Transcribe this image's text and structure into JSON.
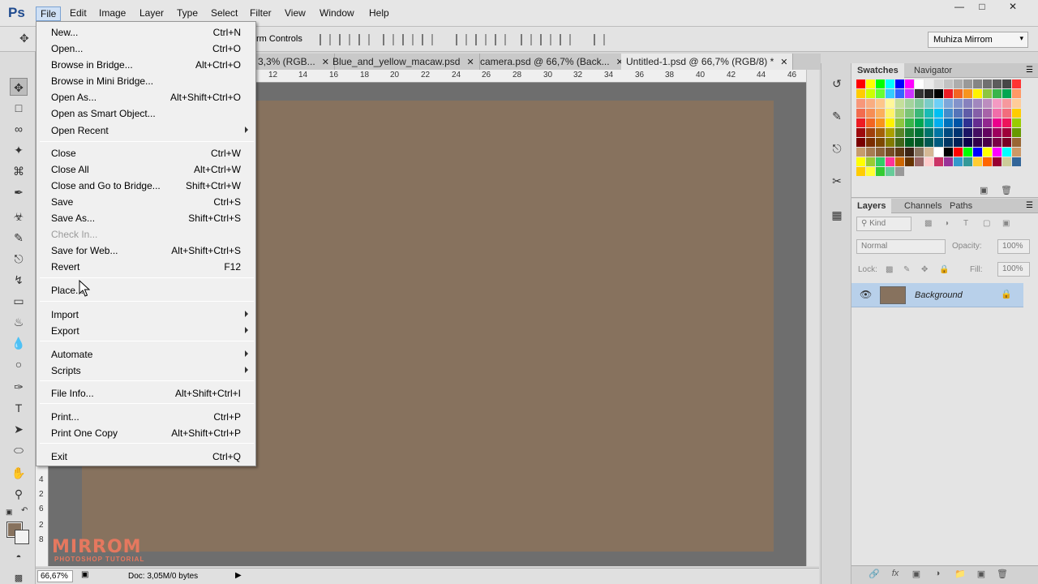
{
  "app": {
    "logo": "Ps",
    "menus": [
      "File",
      "Edit",
      "Image",
      "Layer",
      "Type",
      "Select",
      "Filter",
      "View",
      "Window",
      "Help"
    ],
    "active_menu": "File"
  },
  "options": {
    "partial_label": "rm Controls",
    "workspace": "Muhiza Mirrom"
  },
  "tabs": [
    {
      "label": "3,3% (RGB..."
    },
    {
      "label": "Blue_and_yellow_macaw.psd"
    },
    {
      "label": "camera.psd @ 66,7% (Back..."
    },
    {
      "label": "Untitled-1.psd @ 66,7% (RGB/8) *"
    }
  ],
  "ruler": {
    "h_ticks": [
      "12",
      "14",
      "16",
      "18",
      "20",
      "22",
      "24",
      "26",
      "28",
      "30",
      "32",
      "34",
      "36",
      "38",
      "40",
      "42",
      "44",
      "46"
    ],
    "v_ticks": [
      "4",
      "2",
      "6",
      "2",
      "8"
    ]
  },
  "status": {
    "zoom": "66,67%",
    "doc": "Doc: 3,05M/0 bytes"
  },
  "logo_overlay": {
    "title": "MIRROM",
    "subtitle": "PHOTOSHOP TUTORIAL"
  },
  "swatches_panel": {
    "tabs": [
      "Swatches",
      "Navigator"
    ],
    "colors": [
      "#ff0000",
      "#ffff00",
      "#00ff00",
      "#00ffff",
      "#0000ff",
      "#ff00ff",
      "#ffffff",
      "#ebebeb",
      "#d6d6d6",
      "#c2c2c2",
      "#adadad",
      "#999999",
      "#858585",
      "#707070",
      "#5c5c5c",
      "#474747",
      "#ff3333",
      "#ffcc00",
      "#ccff00",
      "#66ff33",
      "#33ccff",
      "#3366ff",
      "#cc33ff",
      "#333333",
      "#1f1f1f",
      "#000000",
      "#ed1c24",
      "#f26522",
      "#f7941d",
      "#fff200",
      "#8dc63f",
      "#39b54a",
      "#00a651",
      "#ff9966",
      "#f7977a",
      "#f9ad81",
      "#fdc68a",
      "#fff79a",
      "#c4df9b",
      "#a3d39c",
      "#82ca9c",
      "#7accc8",
      "#6dcff6",
      "#7da7d9",
      "#8393ca",
      "#8781bd",
      "#a187be",
      "#bc8dbf",
      "#f49ac2",
      "#f6989d",
      "#ffcc99",
      "#f26c4f",
      "#f68e55",
      "#fbaf5c",
      "#fff467",
      "#acd372",
      "#7cc576",
      "#3bb878",
      "#1abbb4",
      "#00bff3",
      "#438ccb",
      "#5574b9",
      "#605ca8",
      "#855fa8",
      "#a763a8",
      "#f06ea9",
      "#f26d7d",
      "#ffcc00",
      "#ed1c24",
      "#f26522",
      "#f7941d",
      "#fff200",
      "#8dc63f",
      "#39b54a",
      "#00a651",
      "#00a99d",
      "#00aeef",
      "#0072bc",
      "#0054a6",
      "#2e3192",
      "#662d91",
      "#92278f",
      "#ec008c",
      "#ed145b",
      "#99cc00",
      "#9e0b0f",
      "#a0410d",
      "#a36209",
      "#aba000",
      "#598527",
      "#1a7b30",
      "#007236",
      "#00746b",
      "#0076a3",
      "#004b80",
      "#003471",
      "#1b1464",
      "#440e62",
      "#630460",
      "#9e005d",
      "#9e0039",
      "#669900",
      "#790000",
      "#7b2e00",
      "#7d4900",
      "#827b00",
      "#406618",
      "#005e20",
      "#005826",
      "#005952",
      "#005b7f",
      "#003663",
      "#002157",
      "#0d004c",
      "#32004b",
      "#4b0049",
      "#7b0046",
      "#7a0026",
      "#996633",
      "#c69c6d",
      "#a67c52",
      "#8c6239",
      "#754c24",
      "#603913",
      "#3c2415",
      "#8a7560",
      "#d5b895",
      "#ffffff",
      "#000000",
      "#ff0000",
      "#00ff00",
      "#0000ff",
      "#ffff00",
      "#ff00ff",
      "#00ffff",
      "#cc9966",
      "#ffff00",
      "#99cc33",
      "#33cc66",
      "#ff3399",
      "#cc6600",
      "#663300",
      "#996666",
      "#ffcccc",
      "#cc3366",
      "#993399",
      "#3399cc",
      "#339999",
      "#ffcc33",
      "#ff6600",
      "#990033",
      "#cccc99",
      "#336699",
      "#ffcc00",
      "#ffff33",
      "#33cc33",
      "#66cc99",
      "#999999"
    ]
  },
  "layers_panel": {
    "tabs": [
      "Layers",
      "Channels",
      "Paths"
    ],
    "filter": "Kind",
    "blend": "Normal",
    "opacity_label": "Opacity:",
    "opacity": "100%",
    "lock_label": "Lock:",
    "fill_label": "Fill:",
    "fill": "100%",
    "layer_name": "Background"
  },
  "file_menu": {
    "items": [
      {
        "label": "New...",
        "shortcut": "Ctrl+N"
      },
      {
        "label": "Open...",
        "shortcut": "Ctrl+O"
      },
      {
        "label": "Browse in Bridge...",
        "shortcut": "Alt+Ctrl+O"
      },
      {
        "label": "Browse in Mini Bridge...",
        "shortcut": ""
      },
      {
        "label": "Open As...",
        "shortcut": "Alt+Shift+Ctrl+O"
      },
      {
        "label": "Open as Smart Object...",
        "shortcut": ""
      },
      {
        "label": "Open Recent",
        "shortcut": ""
      },
      {
        "label": "Close",
        "shortcut": "Ctrl+W"
      },
      {
        "label": "Close All",
        "shortcut": "Alt+Ctrl+W"
      },
      {
        "label": "Close and Go to Bridge...",
        "shortcut": "Shift+Ctrl+W"
      },
      {
        "label": "Save",
        "shortcut": "Ctrl+S"
      },
      {
        "label": "Save As...",
        "shortcut": "Shift+Ctrl+S"
      },
      {
        "label": "Check In...",
        "shortcut": ""
      },
      {
        "label": "Save for Web...",
        "shortcut": "Alt+Shift+Ctrl+S"
      },
      {
        "label": "Revert",
        "shortcut": "F12"
      },
      {
        "label": "Place...",
        "shortcut": ""
      },
      {
        "label": "Import",
        "shortcut": ""
      },
      {
        "label": "Export",
        "shortcut": ""
      },
      {
        "label": "Automate",
        "shortcut": ""
      },
      {
        "label": "Scripts",
        "shortcut": ""
      },
      {
        "label": "File Info...",
        "shortcut": "Alt+Shift+Ctrl+I"
      },
      {
        "label": "Print...",
        "shortcut": "Ctrl+P"
      },
      {
        "label": "Print One Copy",
        "shortcut": "Alt+Shift+Ctrl+P"
      },
      {
        "label": "Exit",
        "shortcut": "Ctrl+Q"
      }
    ]
  }
}
